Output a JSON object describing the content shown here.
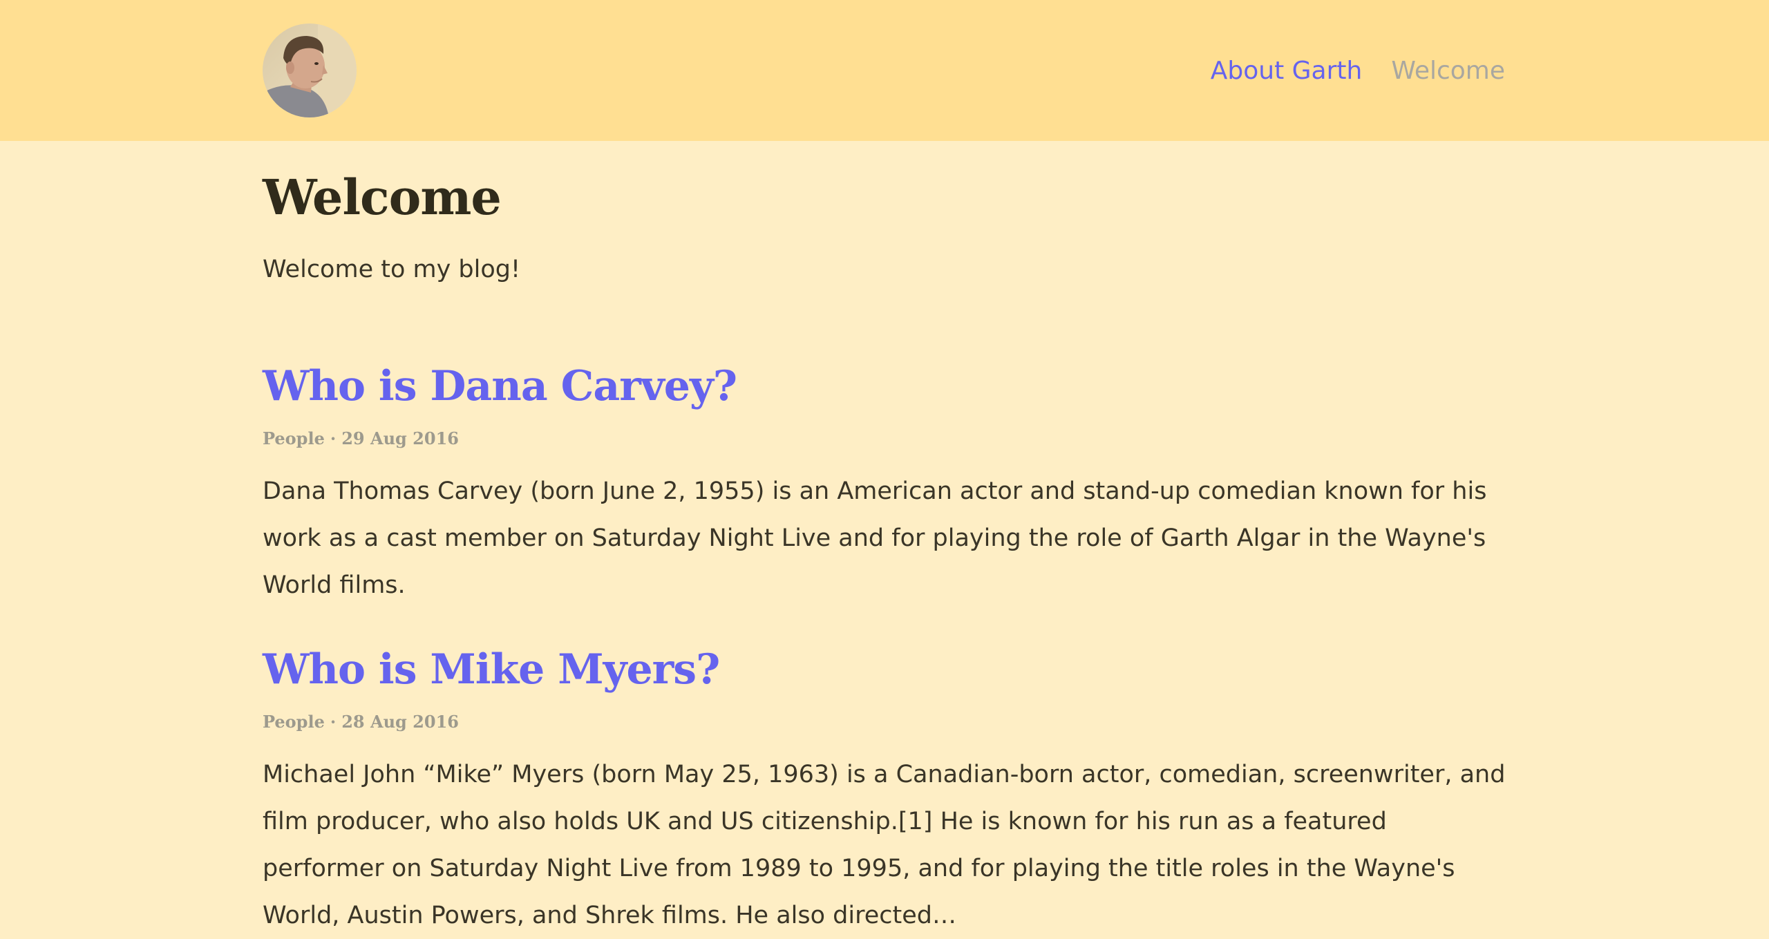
{
  "nav": {
    "items": [
      {
        "label": "About Garth",
        "active": true
      },
      {
        "label": "Welcome",
        "active": false
      }
    ]
  },
  "page": {
    "title": "Welcome",
    "intro": "Welcome to my blog!"
  },
  "posts": [
    {
      "title": "Who is Dana Carvey?",
      "category": "People",
      "separator": "·",
      "date": "29 Aug 2016",
      "excerpt": "Dana Thomas Carvey (born June 2, 1955) is an American actor and stand-up comedian known for his work as a cast member on Saturday Night Live and for playing the role of Garth Algar in the Wayne's World films."
    },
    {
      "title": "Who is Mike Myers?",
      "category": "People",
      "separator": "·",
      "date": "28 Aug 2016",
      "excerpt": "Michael John “Mike” Myers (born May 25, 1963) is a Canadian-born actor, comedian, screenwriter, and film producer, who also holds UK and US citizenship.[1] He is known for his run as a featured performer on Saturday Night Live from 1989 to 1995, and for playing the title roles in the Wayne's World, Austin Powers, and Shrek films. He also directed…"
    }
  ],
  "colors": {
    "header_bg": "#ffdf92",
    "page_bg": "#feeec5",
    "link": "#6563ee",
    "muted": "#a9a7a0",
    "text": "#3a3527"
  }
}
